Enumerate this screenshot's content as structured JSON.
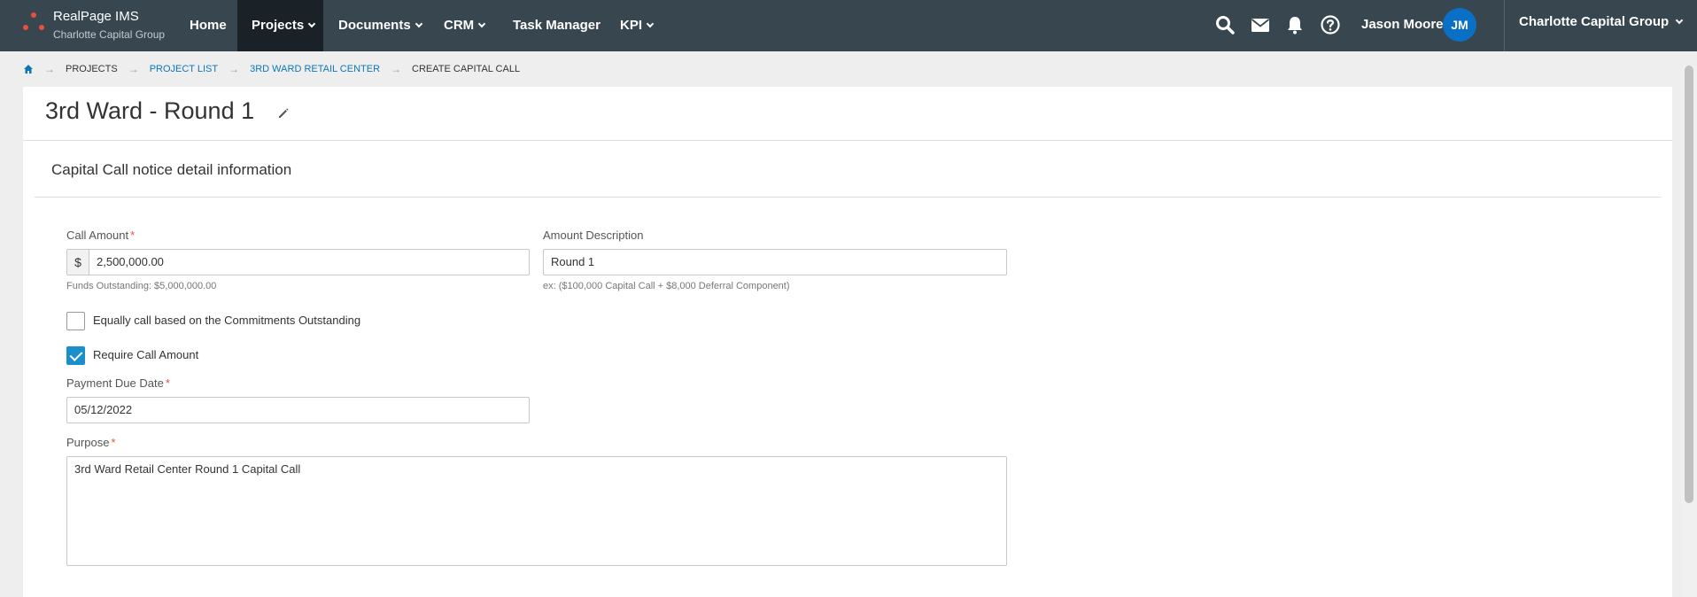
{
  "app": {
    "title": "RealPage IMS",
    "subtitle": "Charlotte Capital Group"
  },
  "nav": {
    "items": [
      {
        "label": "Home",
        "dropdown": false,
        "active": false
      },
      {
        "label": "Projects",
        "dropdown": true,
        "active": true
      },
      {
        "label": "Documents",
        "dropdown": true,
        "active": false
      },
      {
        "label": "CRM",
        "dropdown": true,
        "active": false
      },
      {
        "label": "Task Manager",
        "dropdown": false,
        "active": false
      },
      {
        "label": "KPI",
        "dropdown": true,
        "active": false
      }
    ],
    "icons": [
      "search-icon",
      "mail-icon",
      "bell-icon",
      "help-icon"
    ],
    "user_name": "Jason Moore",
    "user_initials": "JM",
    "org_switch": "Charlotte Capital Group"
  },
  "breadcrumb": [
    "PROJECTS",
    "PROJECT LIST",
    "3RD WARD RETAIL CENTER",
    "CREATE CAPITAL CALL"
  ],
  "page": {
    "title": "3rd Ward - Round 1",
    "section_title": "Capital Call notice detail information"
  },
  "form": {
    "call_amount": {
      "label": "Call Amount",
      "prefix": "$",
      "value": "2,500,000.00",
      "hint": "Funds Outstanding: $5,000,000.00"
    },
    "amount_description": {
      "label": "Amount Description",
      "value": "Round 1",
      "hint": "ex: ($100,000 Capital Call + $8,000 Deferral Component)"
    },
    "equal_call": {
      "label": "Equally call based on the Commitments Outstanding",
      "checked": false
    },
    "require_amount": {
      "label": "Require Call Amount",
      "checked": true
    },
    "payment_due_date": {
      "label": "Payment Due Date",
      "value": "05/12/2022"
    },
    "purpose": {
      "label": "Purpose",
      "value": "3rd Ward Retail Center Round 1 Capital Call"
    },
    "required_marker": "*"
  },
  "colors": {
    "nav_bg": "#37464f",
    "accent": "#0b78b6",
    "avatar": "#0a70c6",
    "required": "#e8513a",
    "checkbox": "#1a8fcc"
  }
}
